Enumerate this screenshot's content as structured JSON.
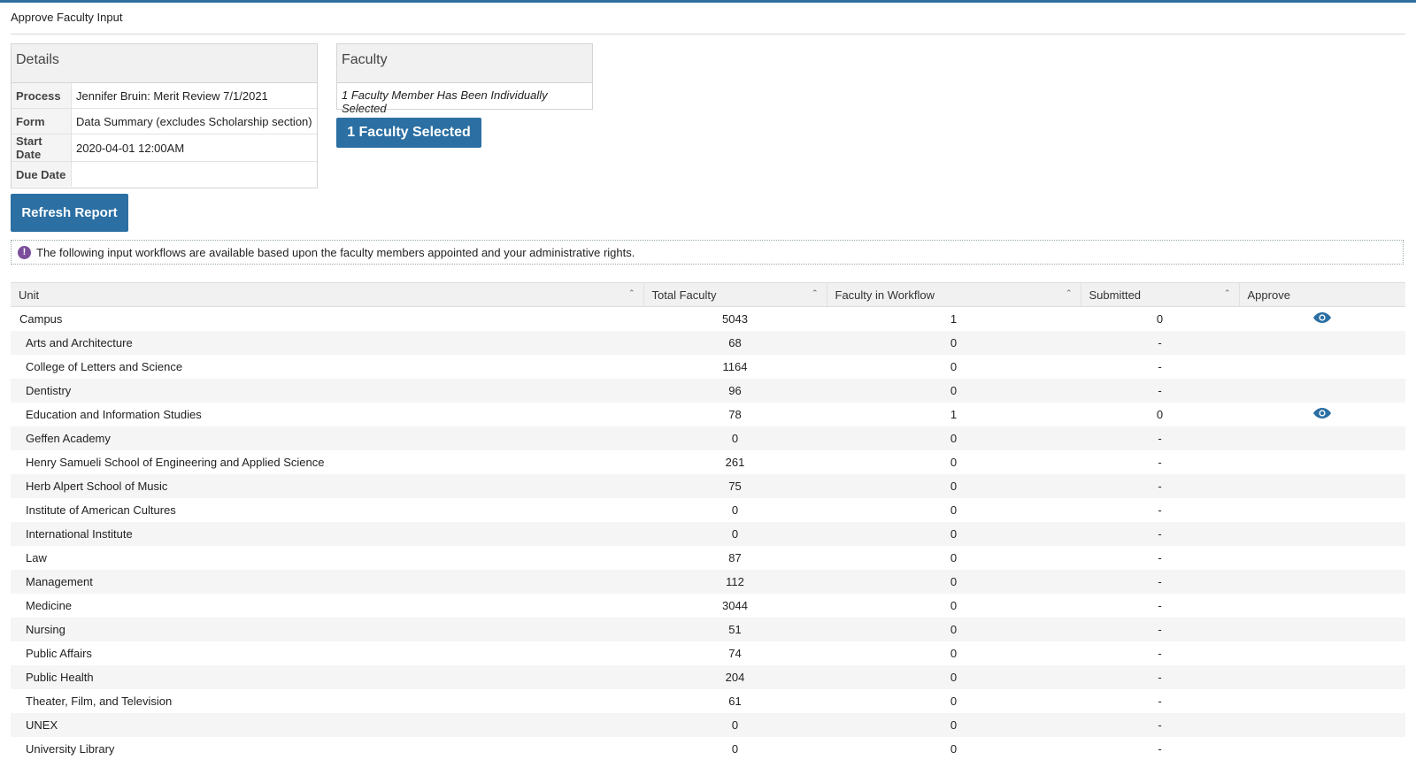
{
  "page": {
    "title": "Approve Faculty Input"
  },
  "details": {
    "heading": "Details",
    "rows": [
      {
        "label": "Process",
        "value": "Jennifer Bruin: Merit Review 7/1/2021"
      },
      {
        "label": "Form",
        "value": "Data Summary (excludes Scholarship section)"
      },
      {
        "label": "Start Date",
        "value": "2020-04-01 12:00AM"
      },
      {
        "label": "Due Date",
        "value": ""
      }
    ]
  },
  "faculty": {
    "heading": "Faculty",
    "note": "1 Faculty Member Has Been Individually Selected",
    "button_label": "1 Faculty Selected"
  },
  "refresh_button_label": "Refresh Report",
  "info_message": "The following input workflows are available based upon the faculty members appointed and your administrative rights.",
  "info_icon": "!",
  "colors": {
    "accent": "#2b6fa3",
    "top_bar": "#2e6e9e",
    "info_icon": "#7b4e9b"
  },
  "table": {
    "columns": [
      "Unit",
      "Total Faculty",
      "Faculty in Workflow",
      "Submitted",
      "Approve"
    ],
    "sort_icon": "⌃",
    "rows": [
      {
        "unit": "Campus",
        "total": "5043",
        "workflow": "1",
        "submitted": "0",
        "approve": true
      },
      {
        "unit": "Arts and Architecture",
        "total": "68",
        "workflow": "0",
        "submitted": "-",
        "approve": false
      },
      {
        "unit": "College of Letters and Science",
        "total": "1164",
        "workflow": "0",
        "submitted": "-",
        "approve": false
      },
      {
        "unit": "Dentistry",
        "total": "96",
        "workflow": "0",
        "submitted": "-",
        "approve": false
      },
      {
        "unit": "Education and Information Studies",
        "total": "78",
        "workflow": "1",
        "submitted": "0",
        "approve": true
      },
      {
        "unit": "Geffen Academy",
        "total": "0",
        "workflow": "0",
        "submitted": "-",
        "approve": false
      },
      {
        "unit": "Henry Samueli School of Engineering and Applied Science",
        "total": "261",
        "workflow": "0",
        "submitted": "-",
        "approve": false
      },
      {
        "unit": "Herb Alpert School of Music",
        "total": "75",
        "workflow": "0",
        "submitted": "-",
        "approve": false
      },
      {
        "unit": "Institute of American Cultures",
        "total": "0",
        "workflow": "0",
        "submitted": "-",
        "approve": false
      },
      {
        "unit": "International Institute",
        "total": "0",
        "workflow": "0",
        "submitted": "-",
        "approve": false
      },
      {
        "unit": "Law",
        "total": "87",
        "workflow": "0",
        "submitted": "-",
        "approve": false
      },
      {
        "unit": "Management",
        "total": "112",
        "workflow": "0",
        "submitted": "-",
        "approve": false
      },
      {
        "unit": "Medicine",
        "total": "3044",
        "workflow": "0",
        "submitted": "-",
        "approve": false
      },
      {
        "unit": "Nursing",
        "total": "51",
        "workflow": "0",
        "submitted": "-",
        "approve": false
      },
      {
        "unit": "Public Affairs",
        "total": "74",
        "workflow": "0",
        "submitted": "-",
        "approve": false
      },
      {
        "unit": "Public Health",
        "total": "204",
        "workflow": "0",
        "submitted": "-",
        "approve": false
      },
      {
        "unit": "Theater, Film, and Television",
        "total": "61",
        "workflow": "0",
        "submitted": "-",
        "approve": false
      },
      {
        "unit": "UNEX",
        "total": "0",
        "workflow": "0",
        "submitted": "-",
        "approve": false
      },
      {
        "unit": "University Library",
        "total": "0",
        "workflow": "0",
        "submitted": "-",
        "approve": false
      }
    ]
  }
}
